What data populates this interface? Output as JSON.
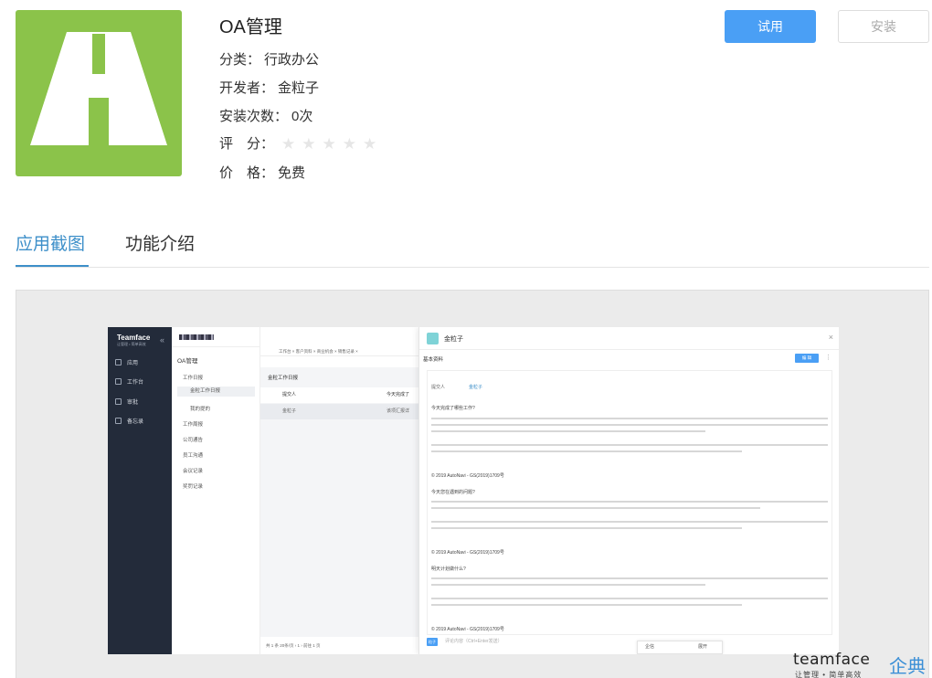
{
  "app": {
    "name": "OA管理",
    "category_label": "分类：",
    "category": "行政办公",
    "developer_label": "开发者：",
    "developer": "金粒子",
    "installs_label": "安装次数：",
    "installs": "0次",
    "rating_label": "评　分：",
    "rating": 0,
    "rating_max": 5,
    "price_label": "价　格：",
    "price": "免费"
  },
  "actions": {
    "try_label": "试用",
    "install_label": "安装"
  },
  "tabs": [
    {
      "label": "应用截图",
      "active": true
    },
    {
      "label": "功能介绍",
      "active": false
    }
  ],
  "screenshot": {
    "brand": "Teamface",
    "brand_sub": "让管理 • 简单高效",
    "nav": [
      "应用",
      "工作台",
      "审批",
      "备忘录"
    ],
    "module_title": "OA管理",
    "menu": [
      "工作日报",
      "金粒工作日报",
      "我的提的",
      "工作周报",
      "公司通告",
      "员工沟通",
      "会议记录",
      "奖罚记录"
    ],
    "tabs_row": "工作台 × 客户资料 × 商业机会 × 销售记录 ×",
    "list_title": "金粒工作日报",
    "col_submitter": "提交人",
    "col_today": "今天完成了",
    "row_submitter": "金粒子",
    "row_today": "该项汇报详",
    "footer": "共 1 条   20条/页   ‹  1  ›   前往  1  页",
    "detail_title": "金粒子",
    "detail_section": "基本资料",
    "edit_label": "编 辑",
    "field_submitter": "提交人",
    "field_submitter_value": "金粒子",
    "q1": "今天完成了哪些工作?",
    "q2": "今天您在遇到的问题?",
    "q3": "明天计划做什么?",
    "copyright": "© 2019 AutoNavi - GS(2019)1709号",
    "comment_placeholder": "评论内容（Ctrl+Enter发送）",
    "avatar_label": "粒子",
    "chip_left": "企信",
    "chip_right": "展开"
  },
  "watermark": {
    "brand": "teamface",
    "cn": "企典",
    "slogan": "让管理 • 简单高效"
  }
}
